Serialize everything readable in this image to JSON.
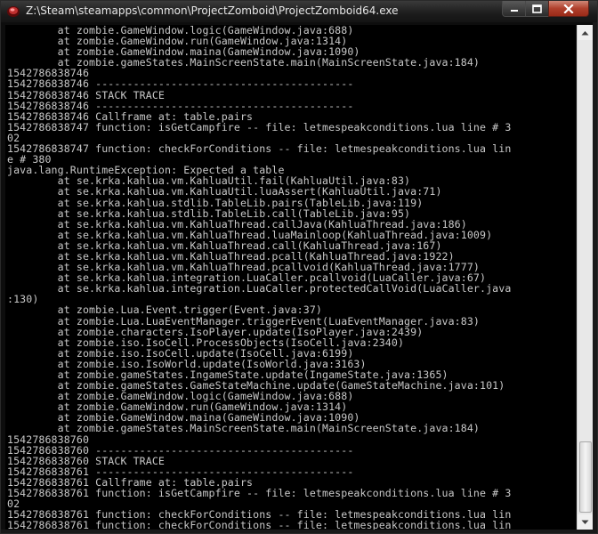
{
  "window": {
    "title": "Z:\\Steam\\steamapps\\common\\ProjectZomboid\\ProjectZomboid64.exe",
    "icon": "project-zomboid-app-icon",
    "buttons": {
      "minimize": "minimize-icon",
      "maximize": "maximize-icon",
      "close": "close-icon"
    }
  },
  "console": {
    "lines": [
      "        at zombie.GameWindow.logic(GameWindow.java:688)",
      "        at zombie.GameWindow.run(GameWindow.java:1314)",
      "        at zombie.GameWindow.maina(GameWindow.java:1090)",
      "        at zombie.gameStates.MainScreenState.main(MainScreenState.java:184)",
      "1542786838746",
      "1542786838746 -----------------------------------------",
      "1542786838746 STACK TRACE",
      "1542786838746 -----------------------------------------",
      "1542786838746 Callframe at: table.pairs",
      "1542786838747 function: isGetCampfire -- file: letmespeakconditions.lua line # 3",
      "02",
      "1542786838747 function: checkForConditions -- file: letmespeakconditions.lua lin",
      "e # 380",
      "java.lang.RuntimeException: Expected a table",
      "        at se.krka.kahlua.vm.KahluaUtil.fail(KahluaUtil.java:83)",
      "        at se.krka.kahlua.vm.KahluaUtil.luaAssert(KahluaUtil.java:71)",
      "        at se.krka.kahlua.stdlib.TableLib.pairs(TableLib.java:119)",
      "        at se.krka.kahlua.stdlib.TableLib.call(TableLib.java:95)",
      "        at se.krka.kahlua.vm.KahluaThread.callJava(KahluaThread.java:186)",
      "        at se.krka.kahlua.vm.KahluaThread.luaMainloop(KahluaThread.java:1009)",
      "        at se.krka.kahlua.vm.KahluaThread.call(KahluaThread.java:167)",
      "        at se.krka.kahlua.vm.KahluaThread.pcall(KahluaThread.java:1922)",
      "        at se.krka.kahlua.vm.KahluaThread.pcallvoid(KahluaThread.java:1777)",
      "        at se.krka.kahlua.integration.LuaCaller.pcallvoid(LuaCaller.java:67)",
      "        at se.krka.kahlua.integration.LuaCaller.protectedCallVoid(LuaCaller.java",
      ":130)",
      "        at zombie.Lua.Event.trigger(Event.java:37)",
      "        at zombie.Lua.LuaEventManager.triggerEvent(LuaEventManager.java:83)",
      "        at zombie.characters.IsoPlayer.update(IsoPlayer.java:2439)",
      "        at zombie.iso.IsoCell.ProcessObjects(IsoCell.java:2340)",
      "        at zombie.iso.IsoCell.update(IsoCell.java:6199)",
      "        at zombie.iso.IsoWorld.update(IsoWorld.java:3163)",
      "        at zombie.gameStates.IngameState.update(IngameState.java:1365)",
      "        at zombie.gameStates.GameStateMachine.update(GameStateMachine.java:101)",
      "        at zombie.GameWindow.logic(GameWindow.java:688)",
      "        at zombie.GameWindow.run(GameWindow.java:1314)",
      "        at zombie.GameWindow.maina(GameWindow.java:1090)",
      "        at zombie.gameStates.MainScreenState.main(MainScreenState.java:184)",
      "1542786838760",
      "1542786838760 -----------------------------------------",
      "1542786838760 STACK TRACE",
      "1542786838761 -----------------------------------------",
      "1542786838761 Callframe at: table.pairs",
      "1542786838761 function: isGetCampfire -- file: letmespeakconditions.lua line # 3",
      "02",
      "1542786838761 function: checkForConditions -- file: letmespeakconditions.lua lin",
      "1542786838761 function: checkForConditions -- file: letmespeakconditions.lua lin"
    ]
  },
  "scrollbar": {
    "up": "scroll-up-arrow-icon",
    "down": "scroll-down-arrow-icon",
    "position": 0.95
  }
}
